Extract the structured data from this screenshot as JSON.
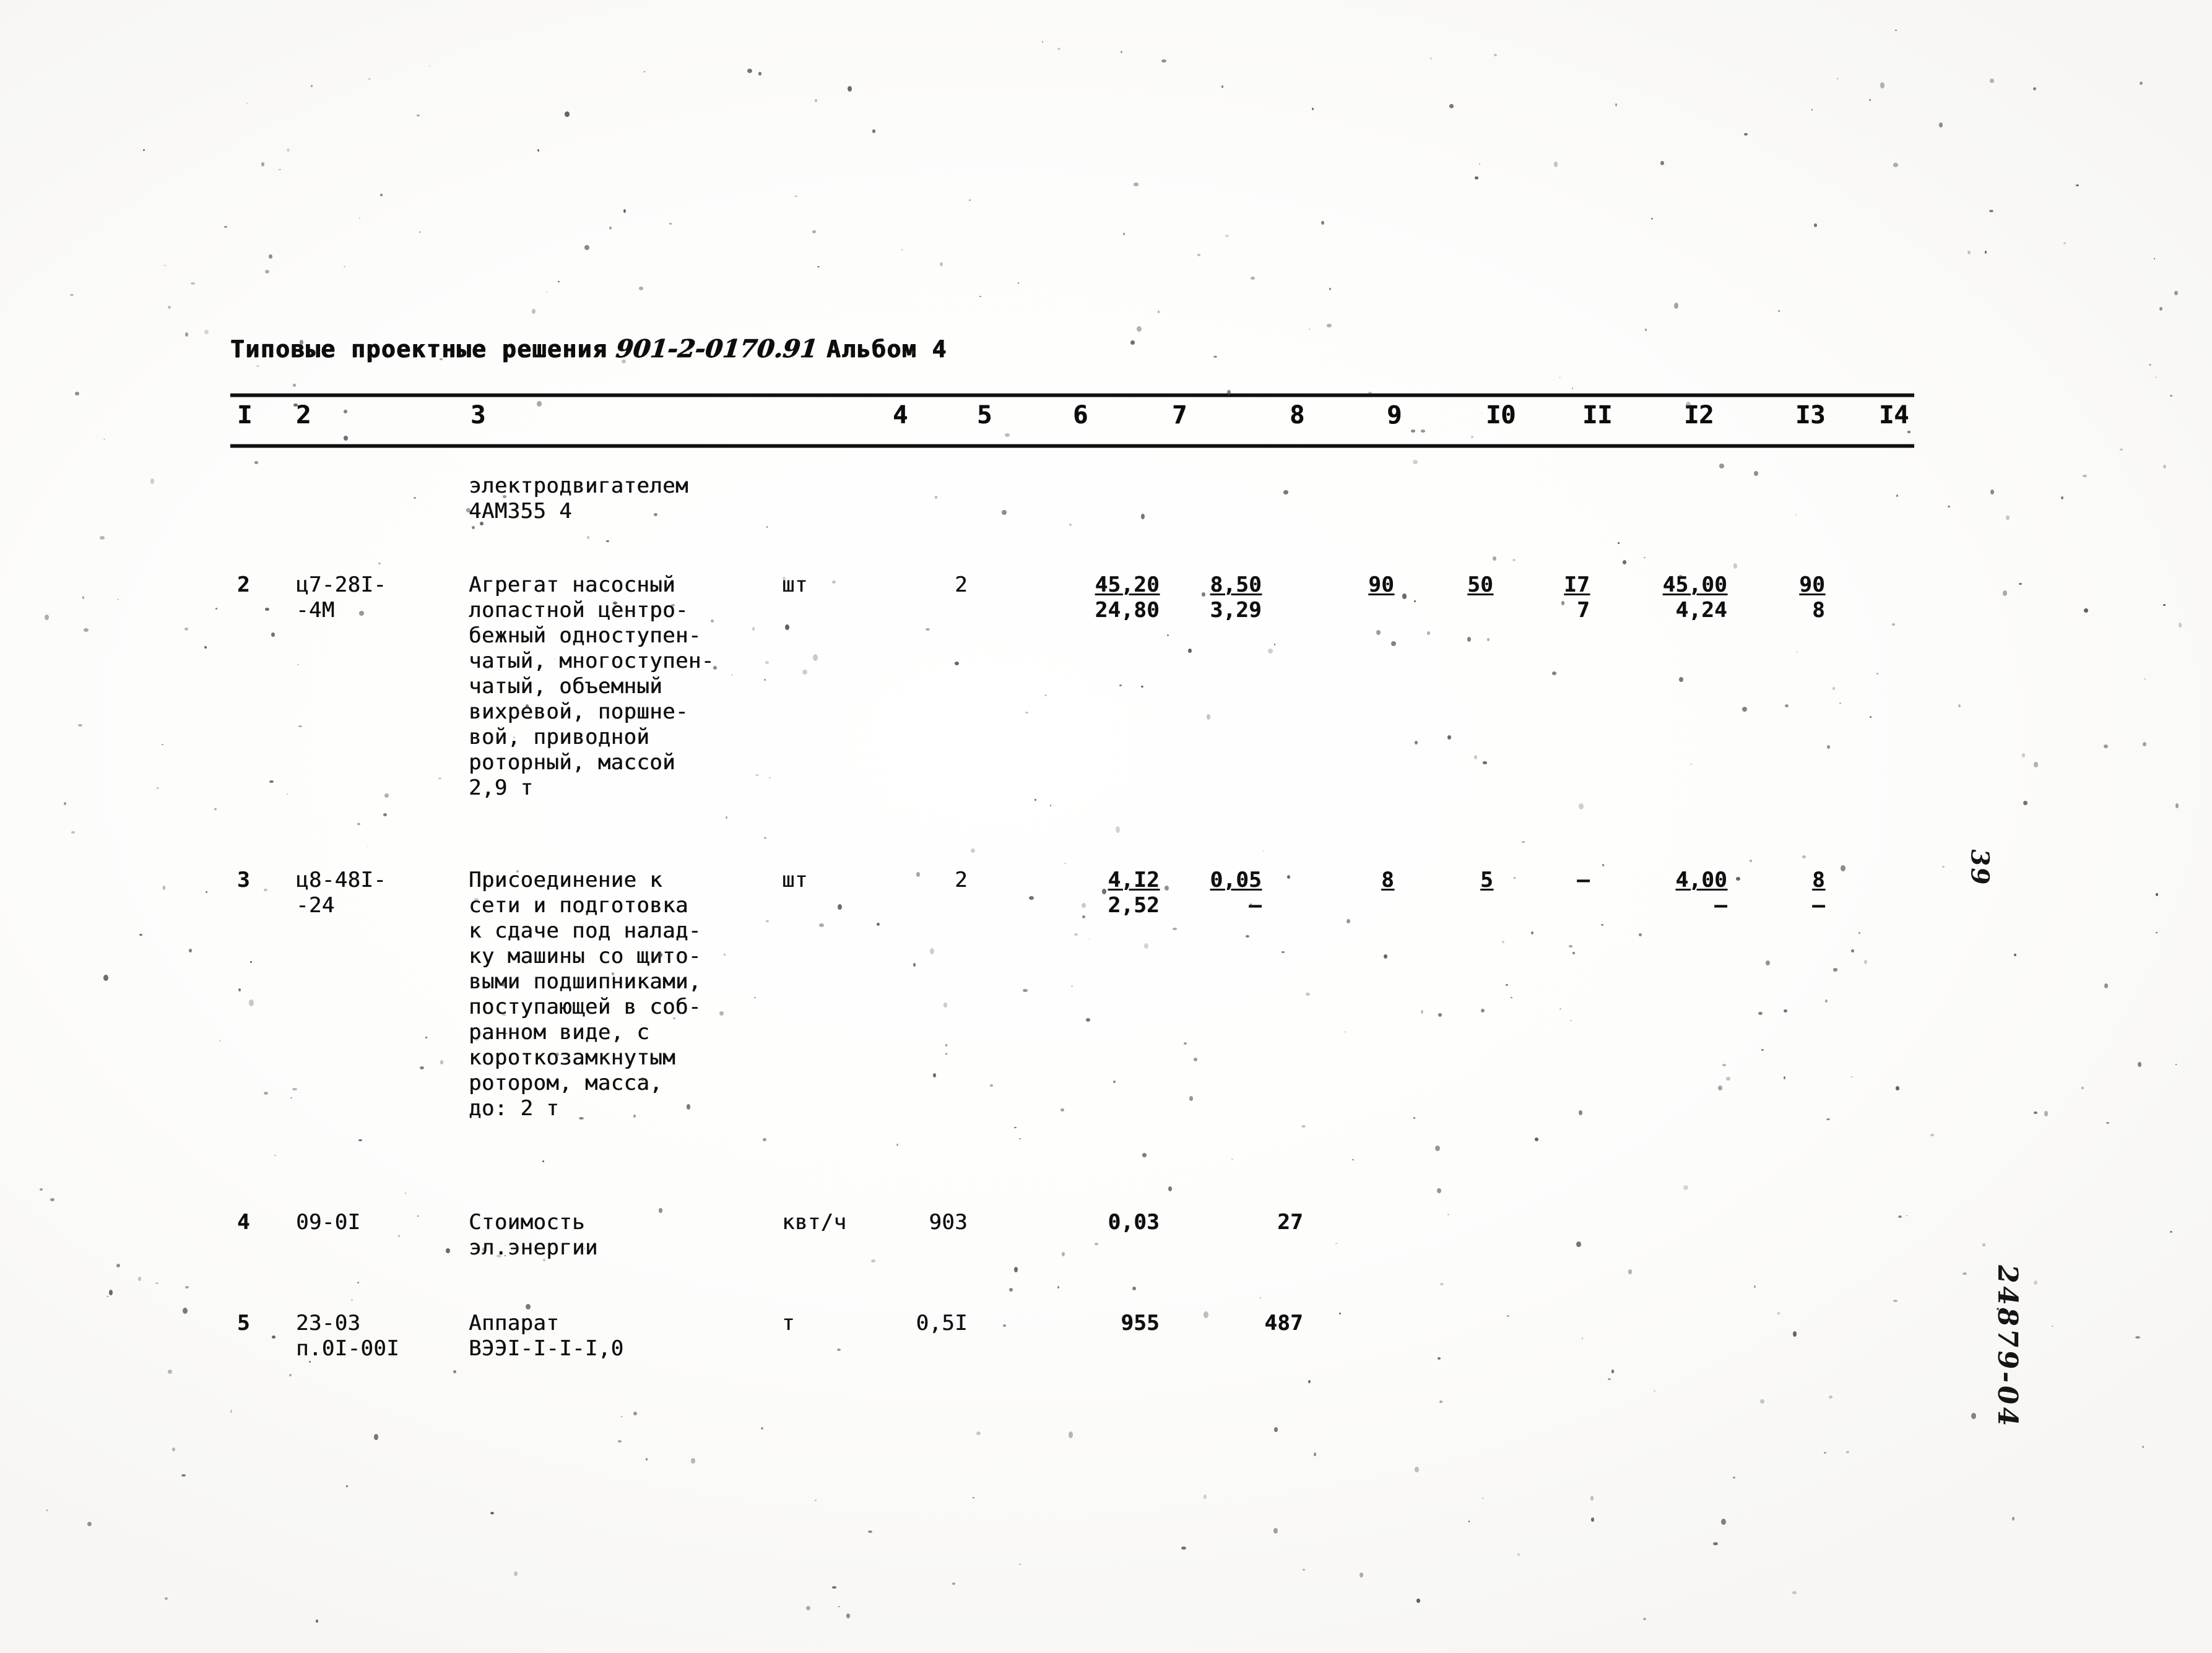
{
  "header": {
    "prefix": "Типовые проектные решения",
    "project_code": "901-2-0170.91",
    "album_label": "Альбом 4"
  },
  "table": {
    "column_numbers": [
      "I",
      "2",
      "3",
      "4",
      "5",
      "6",
      "7",
      "8",
      "9",
      "I0",
      "II",
      "I2",
      "I3",
      "I4"
    ],
    "continuation": {
      "description_lines": [
        "электродвигателем",
        "4АМ355 4"
      ]
    },
    "rows": [
      {
        "num": "2",
        "code_lines": [
          "ц7-28I-",
          "-4М"
        ],
        "description_lines": [
          "Агрегат насосный",
          "лопастной центро-",
          "бежный одноступен-",
          "чатый, многоступен-",
          "чатый, объемный",
          "вихревой, поршне-",
          "вой, приводной",
          "роторный, массой",
          "2,9 т"
        ],
        "unit": "шт",
        "qty": "2",
        "c6_top": "45,20",
        "c6_bot": "24,80",
        "c7_top": "8,50",
        "c7_bot": "3,29",
        "c8": "",
        "c9": "90",
        "c10": "50",
        "c11_top": "I7",
        "c11_bot": "7",
        "c12_top": "45,00",
        "c12_bot": "4,24",
        "c13_top": "90",
        "c13_bot": "8"
      },
      {
        "num": "3",
        "code_lines": [
          "ц8-48I-",
          "-24"
        ],
        "description_lines": [
          "Присоединение к",
          "сети и подготовка",
          "к сдаче под налад-",
          "ку машины со щито-",
          "выми подшипниками,",
          "поступающей в соб-",
          "ранном виде, с",
          "короткозамкнутым",
          "ротором, масса,",
          "до: 2 т"
        ],
        "unit": "шт",
        "qty": "2",
        "c6_top": "4,I2",
        "c6_bot": "2,52",
        "c7_top": "0,05",
        "c7_bot": "–",
        "c8": "",
        "c9": "8",
        "c10": "5",
        "c11_top": "–",
        "c11_bot": "",
        "c12_top": "4,00",
        "c12_bot": "–",
        "c13_top": "8",
        "c13_bot": "–"
      },
      {
        "num": "4",
        "code_lines": [
          "09-0I"
        ],
        "description_lines": [
          "Стоимость",
          "эл.энергии"
        ],
        "unit": "квт/ч",
        "qty": "903",
        "c6_top": "0,03",
        "c6_bot": "",
        "c7_top": "",
        "c7_bot": "",
        "c8": "27",
        "c9": "",
        "c10": "",
        "c11_top": "",
        "c11_bot": "",
        "c12_top": "",
        "c12_bot": "",
        "c13_top": "",
        "c13_bot": ""
      },
      {
        "num": "5",
        "code_lines": [
          "23-03",
          "п.0I-00I"
        ],
        "description_lines": [
          "Аппарат",
          "ВЭЭI-I-I-I,0"
        ],
        "unit": "т",
        "qty": "0,5I",
        "c6_top": "955",
        "c6_bot": "",
        "c7_top": "",
        "c7_bot": "",
        "c8": "487",
        "c9": "",
        "c10": "",
        "c11_top": "",
        "c11_bot": "",
        "c12_top": "",
        "c12_bot": "",
        "c13_top": "",
        "c13_bot": ""
      }
    ]
  },
  "margin": {
    "page_number": "39",
    "archive_number": "24879-04"
  }
}
